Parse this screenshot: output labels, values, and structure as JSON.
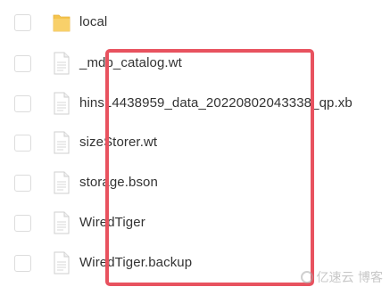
{
  "files": [
    {
      "name": "local",
      "type": "folder",
      "icon": "folder-icon"
    },
    {
      "name": "_mdb_catalog.wt",
      "type": "file",
      "icon": "document-icon"
    },
    {
      "name": "hins14438959_data_20220802043338_qp.xb",
      "type": "file",
      "icon": "document-icon"
    },
    {
      "name": "sizeStorer.wt",
      "type": "file",
      "icon": "document-icon"
    },
    {
      "name": "storage.bson",
      "type": "file",
      "icon": "document-icon"
    },
    {
      "name": "WiredTiger",
      "type": "file",
      "icon": "document-icon"
    },
    {
      "name": "WiredTiger.backup",
      "type": "file",
      "icon": "document-icon"
    }
  ],
  "annotation": {
    "color": "#e8525f"
  },
  "watermark": {
    "text": "亿速云 博客"
  },
  "colors": {
    "folder": "#f5c44e",
    "file_outline": "#d0d0d0",
    "text": "#333333"
  }
}
